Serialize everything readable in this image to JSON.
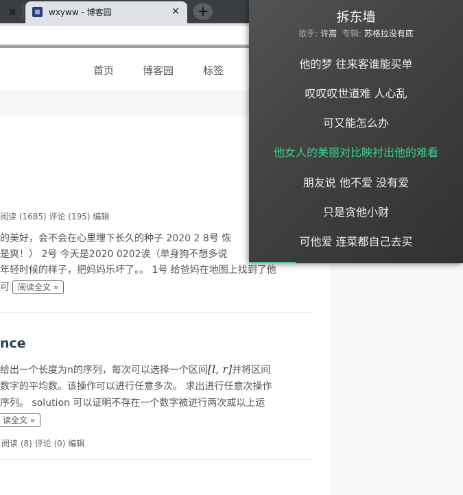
{
  "browser": {
    "tab_title": "wxyww - 博客园",
    "prev_tab_close": "✕",
    "tab_close": "✕",
    "new_tab": "+"
  },
  "nav": {
    "items": [
      "首页",
      "博客园",
      "标签"
    ]
  },
  "posts": [
    {
      "meta": "阅读 (1685) 评论 (195) 编辑",
      "desc_lines": [
        "的美好，会不会在心里埋下长久的种子 2020 2 8号 恢",
        "是爽！） 2号 今天是2020 0202诶（单身狗不想多说",
        "年轻时候的样子，把妈妈乐坏了。。 1号 给爸妈在地图上找到了他"
      ],
      "desc_tail": "可",
      "read_more": "阅读全文 »"
    },
    {
      "title": "nce",
      "desc_lines": [
        "给出一个长度为n的序列，每次可以选择一个区间",
        "数字的平均数。该操作可以进行任意多次。 求出进行任意次操作",
        "序列。 solution 可以证明不存在一个数字被进行两次或以上运"
      ],
      "math": "[l, r]",
      "desc_after_math": "并将区间",
      "read_more": "读全文 »",
      "meta": "阅读 (8) 评论 (0) 编辑"
    }
  ],
  "lyrics_panel": {
    "song": "拆东墙",
    "singer_label": "歌手:",
    "singer": "许嵩",
    "album_label": "专辑:",
    "album": "苏格拉没有底",
    "lines": [
      "他的梦 往来客谁能买单",
      "叹叹叹世道难 人心乱",
      "可又能怎么办",
      "他女人的美丽对比映衬出他的难看",
      "朋友说 他不爱 没有爱",
      "只是贪他小财",
      "可他爱 连菜都自己去买"
    ],
    "current_line_index": 3,
    "accent_color": "#3ecf8e"
  }
}
